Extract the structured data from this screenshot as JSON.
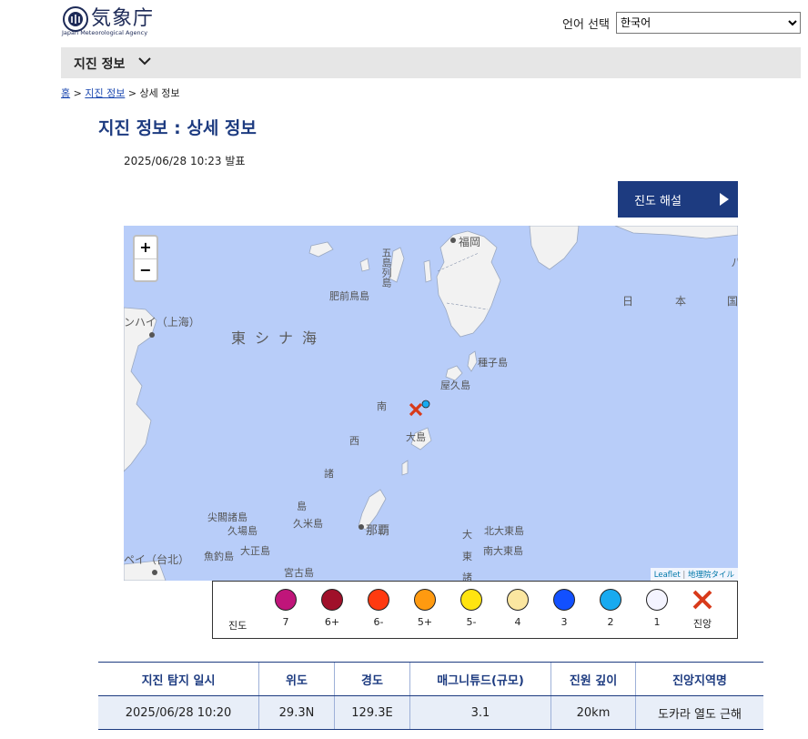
{
  "header": {
    "logo_text": "気象庁",
    "logo_subtitle": "Japan Meteorological Agency",
    "language_label": "언어 선택",
    "language_selected": "한국어"
  },
  "menu": {
    "label": "지진 정보"
  },
  "breadcrumb": {
    "home": "홈",
    "sep1": ">",
    "section": "지진 정보",
    "sep2": ">",
    "current": "상세 정보"
  },
  "page": {
    "title": "지진 정보 : 상세 정보",
    "issued": "2025/06/28 10:23 발표",
    "explain_button": "진도 해설"
  },
  "map": {
    "zoom_in": "+",
    "zoom_out": "−",
    "attribution_leaflet": "Leaflet",
    "attribution_sep": "|",
    "attribution_gsi": "地理院タイル",
    "labels": {
      "fukuoka": "福岡",
      "hizen": "肥前鳥島",
      "shanghai": "ンハイ（上海）",
      "east_china_sea": "東シナ海",
      "tanegashima": "種子島",
      "yakushima": "屋久島",
      "oshima": "大島",
      "senkaku": "尖閣諸島",
      "kuba": "久場島",
      "taisho": "大正島",
      "uotsuri": "魚釣島",
      "kume": "久米島",
      "naha": "那覇",
      "kitadaito": "北大東島",
      "minamidaito": "南大東島",
      "taipei": "ペイ（台北）",
      "miyako": "宮古島",
      "nihon": "日",
      "nihon2": "本",
      "nihon3": "国",
      "nansei1": "南",
      "nansei2": "西",
      "nansei3": "諸",
      "nansei4": "島",
      "daito1": "大",
      "daito2": "東",
      "daito3": "諸",
      "goto": "五島列島",
      "ha": "八"
    }
  },
  "legend": {
    "title": "진도",
    "items": [
      {
        "label": "7",
        "color": "#c0157a"
      },
      {
        "label": "6+",
        "color": "#a0102a"
      },
      {
        "label": "6-",
        "color": "#ff3a10"
      },
      {
        "label": "5+",
        "color": "#ff9a10"
      },
      {
        "label": "5-",
        "color": "#ffe410"
      },
      {
        "label": "4",
        "color": "#fbe6a0"
      },
      {
        "label": "3",
        "color": "#1250ff"
      },
      {
        "label": "2",
        "color": "#18aaf0"
      },
      {
        "label": "1",
        "color": "#f4f4ff"
      }
    ],
    "epicenter_label": "진앙",
    "epicenter_color": "#d83a1a"
  },
  "table": {
    "headers": [
      "지진 탐지 일시",
      "위도",
      "경도",
      "매그니튜드(규모)",
      "진원 깊이",
      "진앙지역명"
    ],
    "row": [
      "2025/06/28 10:20",
      "29.3N",
      "129.3E",
      "3.1",
      "20km",
      "도카라 열도 근해"
    ]
  },
  "colors": {
    "accent": "#1d3b80",
    "sea": "#b8cdf9",
    "land": "#f2f2f2"
  }
}
